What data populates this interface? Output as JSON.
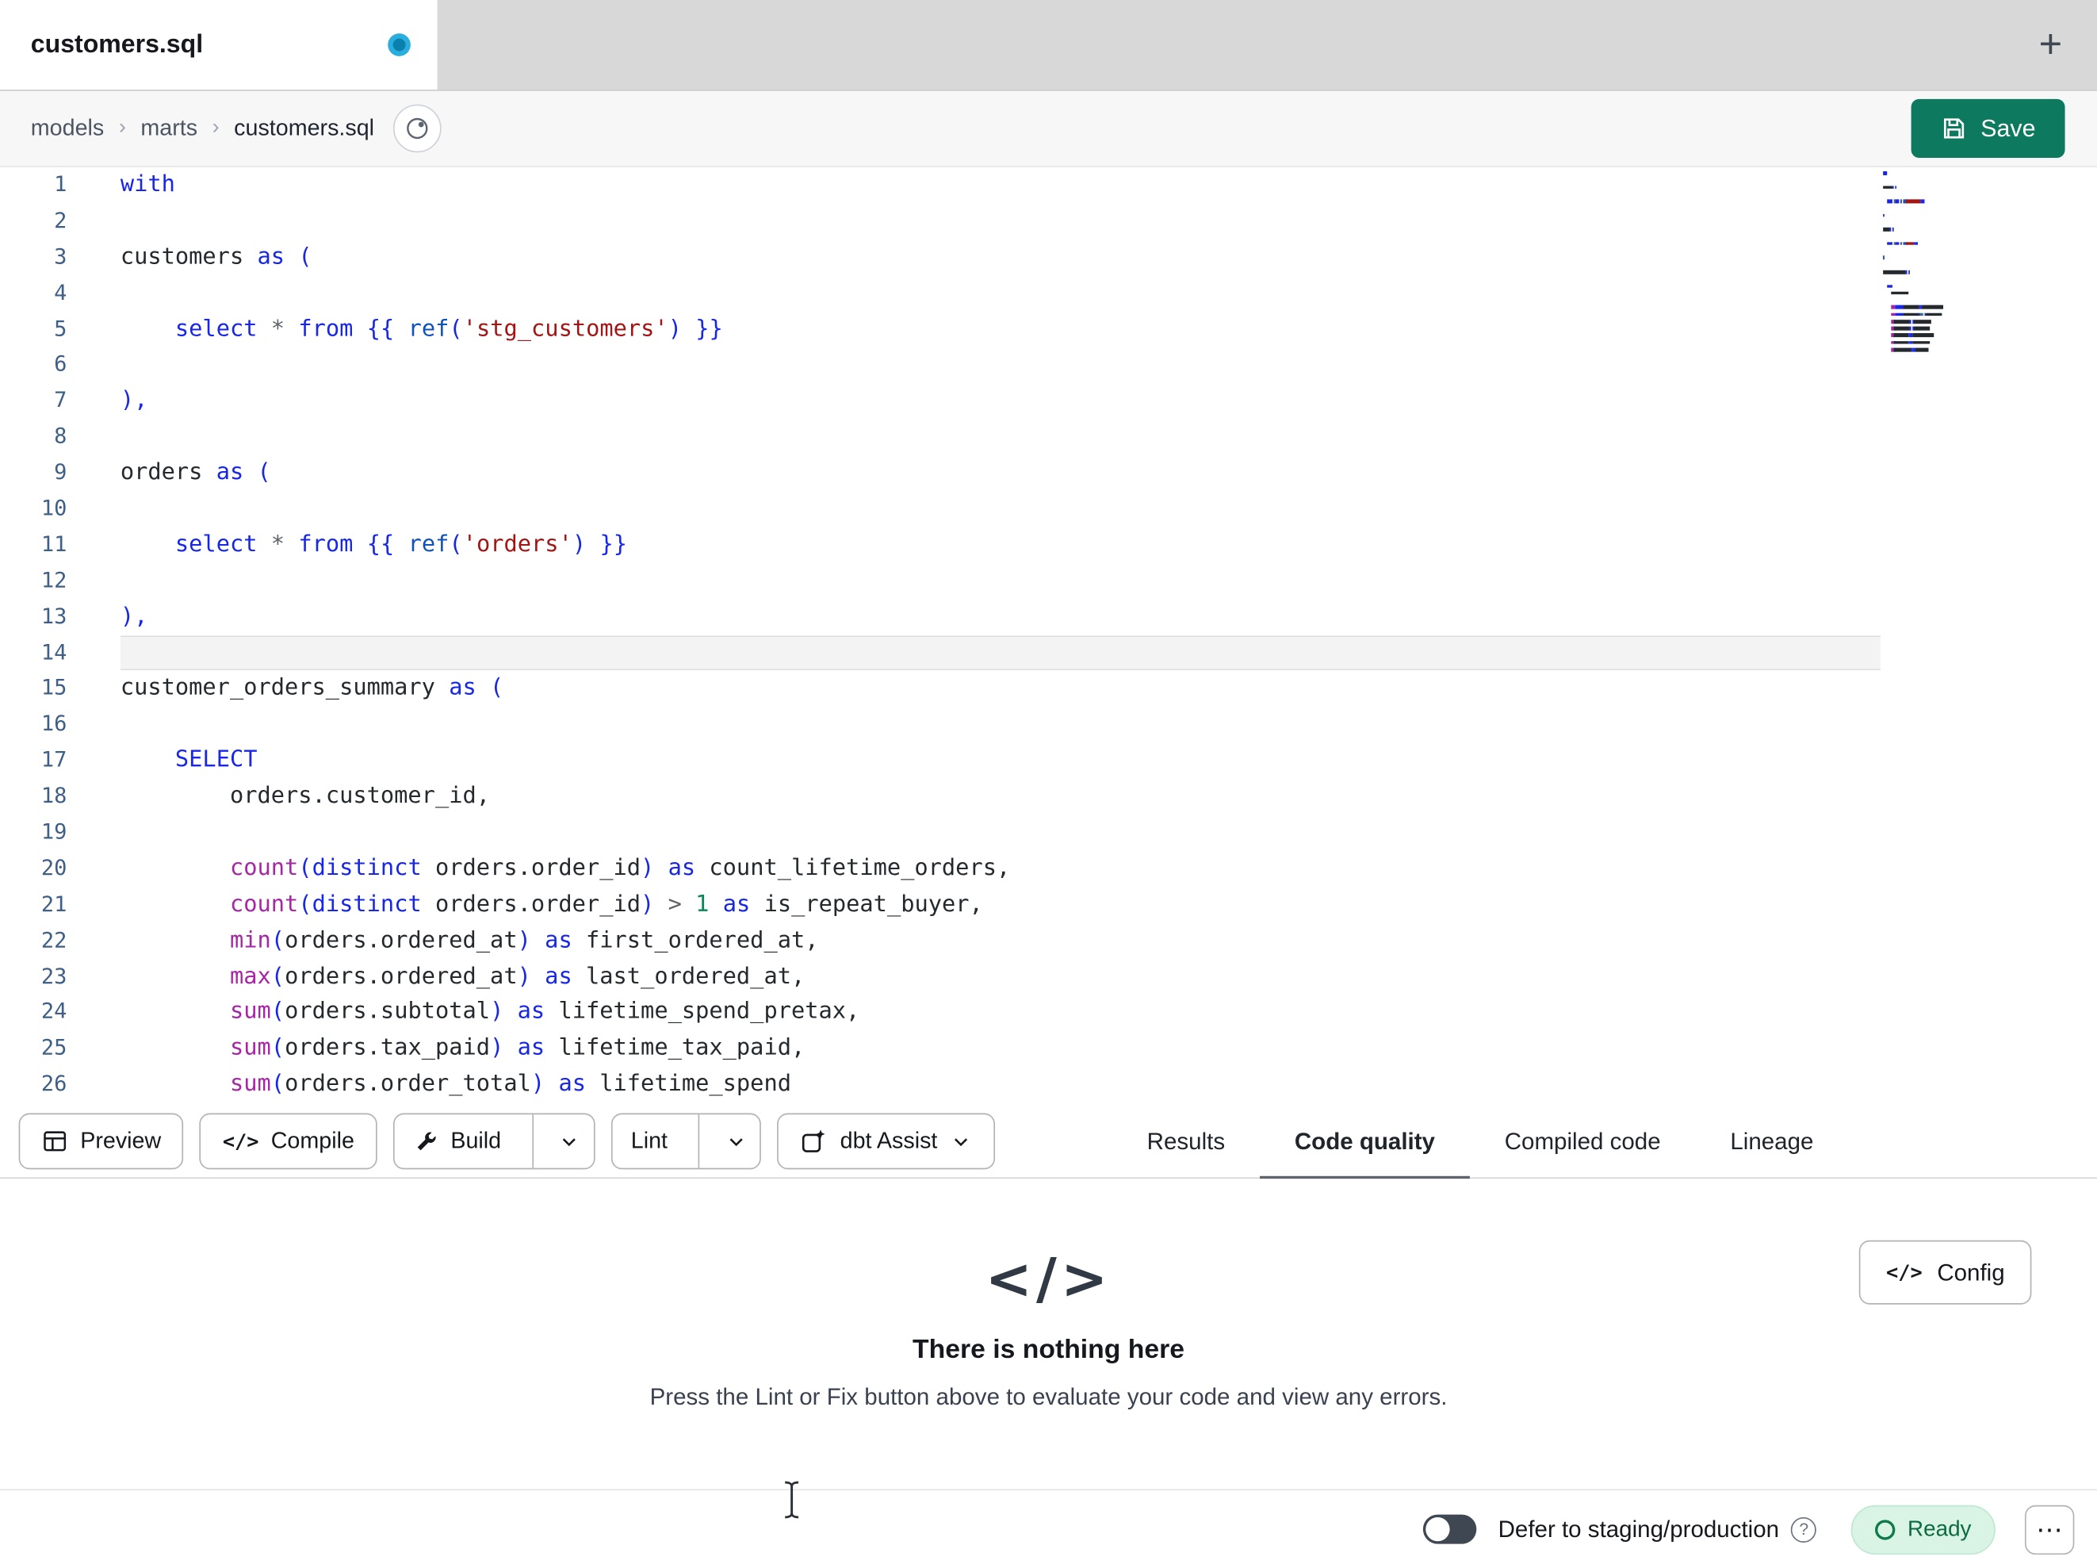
{
  "tab_bar": {
    "active_tab_label": "customers.sql",
    "new_tab_icon": "+"
  },
  "breadcrumb": {
    "items": [
      "models",
      "marts",
      "customers.sql"
    ],
    "separator": "›"
  },
  "save_button": {
    "label": "Save"
  },
  "editor": {
    "active_line": 14,
    "lines": [
      [
        [
          "kw",
          "with"
        ]
      ],
      [],
      [
        [
          "id",
          "customers "
        ],
        [
          "kw",
          "as"
        ],
        [
          "id",
          " "
        ],
        [
          "br",
          "("
        ]
      ],
      [],
      [
        [
          "ws",
          "    "
        ],
        [
          "kw",
          "select"
        ],
        [
          "id",
          " "
        ],
        [
          "op",
          "*"
        ],
        [
          "id",
          " "
        ],
        [
          "kw",
          "from"
        ],
        [
          "id",
          " "
        ],
        [
          "jj",
          "{{"
        ],
        [
          "id",
          " "
        ],
        [
          "ref",
          "ref"
        ],
        [
          "br",
          "("
        ],
        [
          "str",
          "'stg_customers'"
        ],
        [
          "br",
          ")"
        ],
        [
          "id",
          " "
        ],
        [
          "jj",
          "}}"
        ]
      ],
      [],
      [
        [
          "br",
          "),"
        ]
      ],
      [],
      [
        [
          "id",
          "orders "
        ],
        [
          "kw",
          "as"
        ],
        [
          "id",
          " "
        ],
        [
          "br",
          "("
        ]
      ],
      [],
      [
        [
          "ws",
          "    "
        ],
        [
          "kw",
          "select"
        ],
        [
          "id",
          " "
        ],
        [
          "op",
          "*"
        ],
        [
          "id",
          " "
        ],
        [
          "kw",
          "from"
        ],
        [
          "id",
          " "
        ],
        [
          "jj",
          "{{"
        ],
        [
          "id",
          " "
        ],
        [
          "ref",
          "ref"
        ],
        [
          "br",
          "("
        ],
        [
          "str",
          "'orders'"
        ],
        [
          "br",
          ")"
        ],
        [
          "id",
          " "
        ],
        [
          "jj",
          "}}"
        ]
      ],
      [],
      [
        [
          "br",
          "),"
        ]
      ],
      [],
      [
        [
          "id",
          "customer_orders_summary "
        ],
        [
          "kw",
          "as"
        ],
        [
          "id",
          " "
        ],
        [
          "br",
          "("
        ]
      ],
      [],
      [
        [
          "ws",
          "    "
        ],
        [
          "kw",
          "SELECT"
        ]
      ],
      [
        [
          "ws",
          "        "
        ],
        [
          "id",
          "orders.customer_id,"
        ]
      ],
      [],
      [
        [
          "ws",
          "        "
        ],
        [
          "fn",
          "count"
        ],
        [
          "br",
          "("
        ],
        [
          "kw",
          "distinct"
        ],
        [
          "id",
          " orders.order_id"
        ],
        [
          "br",
          ")"
        ],
        [
          "id",
          " "
        ],
        [
          "kw",
          "as"
        ],
        [
          "id",
          " count_lifetime_orders,"
        ]
      ],
      [
        [
          "ws",
          "        "
        ],
        [
          "fn",
          "count"
        ],
        [
          "br",
          "("
        ],
        [
          "kw",
          "distinct"
        ],
        [
          "id",
          " orders.order_id"
        ],
        [
          "br",
          ")"
        ],
        [
          "id",
          " "
        ],
        [
          "op",
          ">"
        ],
        [
          "id",
          " "
        ],
        [
          "num",
          "1"
        ],
        [
          "id",
          " "
        ],
        [
          "kw",
          "as"
        ],
        [
          "id",
          " is_repeat_buyer,"
        ]
      ],
      [
        [
          "ws",
          "        "
        ],
        [
          "fn",
          "min"
        ],
        [
          "br",
          "("
        ],
        [
          "id",
          "orders.ordered_at"
        ],
        [
          "br",
          ")"
        ],
        [
          "id",
          " "
        ],
        [
          "kw",
          "as"
        ],
        [
          "id",
          " first_ordered_at,"
        ]
      ],
      [
        [
          "ws",
          "        "
        ],
        [
          "fn",
          "max"
        ],
        [
          "br",
          "("
        ],
        [
          "id",
          "orders.ordered_at"
        ],
        [
          "br",
          ")"
        ],
        [
          "id",
          " "
        ],
        [
          "kw",
          "as"
        ],
        [
          "id",
          " last_ordered_at,"
        ]
      ],
      [
        [
          "ws",
          "        "
        ],
        [
          "fn",
          "sum"
        ],
        [
          "br",
          "("
        ],
        [
          "id",
          "orders.subtotal"
        ],
        [
          "br",
          ")"
        ],
        [
          "id",
          " "
        ],
        [
          "kw",
          "as"
        ],
        [
          "id",
          " lifetime_spend_pretax,"
        ]
      ],
      [
        [
          "ws",
          "        "
        ],
        [
          "fn",
          "sum"
        ],
        [
          "br",
          "("
        ],
        [
          "id",
          "orders.tax_paid"
        ],
        [
          "br",
          ")"
        ],
        [
          "id",
          " "
        ],
        [
          "kw",
          "as"
        ],
        [
          "id",
          " lifetime_tax_paid,"
        ]
      ],
      [
        [
          "ws",
          "        "
        ],
        [
          "fn",
          "sum"
        ],
        [
          "br",
          "("
        ],
        [
          "id",
          "orders.order_total"
        ],
        [
          "br",
          ")"
        ],
        [
          "id",
          " "
        ],
        [
          "kw",
          "as"
        ],
        [
          "id",
          " lifetime_spend"
        ]
      ]
    ]
  },
  "toolbar": {
    "preview_label": "Preview",
    "compile_label": "Compile",
    "compile_icon": "</>",
    "build_label": "Build",
    "lint_label": "Lint",
    "assist_label": "dbt Assist"
  },
  "result_tabs": {
    "results": "Results",
    "code_quality": "Code quality",
    "compiled_code": "Compiled code",
    "lineage": "Lineage",
    "active": "Code quality"
  },
  "empty_state": {
    "icon": "</>",
    "title": "There is nothing here",
    "subtitle": "Press the Lint or Fix button above to evaluate your code and view any errors."
  },
  "config_button": {
    "icon": "</>",
    "label": "Config"
  },
  "status_bar": {
    "defer_label": "Defer to staging/production",
    "defer_toggle_on": false,
    "help_icon": "?",
    "ready_label": "Ready",
    "overflow_icon": "⋯"
  },
  "colors": {
    "save_button_bg": "#0d7a5f",
    "dirty_dot": "#1d9fd6",
    "ready_bg": "#d9f3e5",
    "ready_text": "#0c6b41",
    "active_line_bg": "#f3f3f3",
    "tokens": {
      "kw": "#1726e8",
      "br": "#1726e8",
      "jj": "#1726e8",
      "ref": "#0f52ba",
      "fn": "#a626a4",
      "str": "#a31515",
      "num": "#098658",
      "op": "#5f6368",
      "id": "#24292e",
      "ws": "transparent"
    }
  }
}
